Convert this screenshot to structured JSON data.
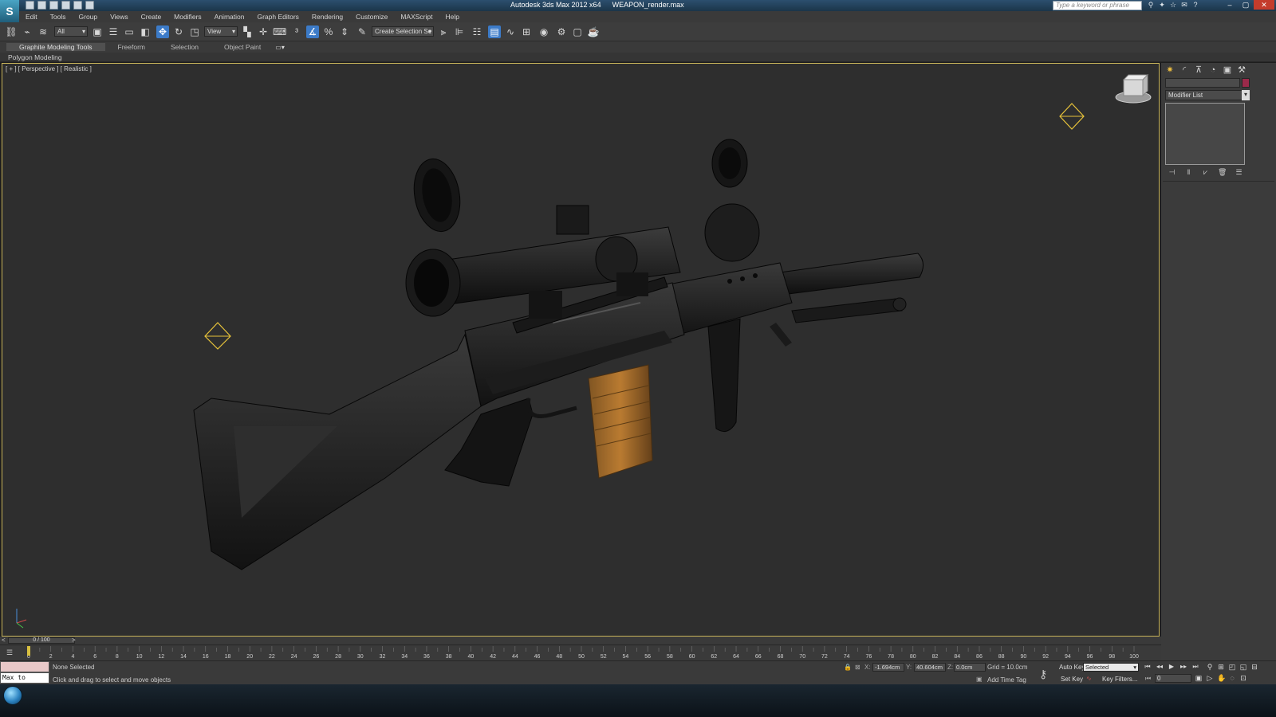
{
  "window": {
    "app_title": "Autodesk 3ds Max  2012 x64",
    "file_name": "WEAPON_render.max",
    "search_placeholder": "Type a keyword or phrase"
  },
  "menu": [
    "Edit",
    "Tools",
    "Group",
    "Views",
    "Create",
    "Modifiers",
    "Animation",
    "Graph Editors",
    "Rendering",
    "Customize",
    "MAXScript",
    "Help"
  ],
  "toolbar": {
    "selection_filter": "All",
    "reference_coord": "View",
    "named_selection": "Create Selection Se"
  },
  "ribbon": {
    "tabs": [
      "Graphite Modeling Tools",
      "Freeform",
      "Selection",
      "Object Paint"
    ],
    "active_tab": "Graphite Modeling Tools",
    "panel_label": "Polygon Modeling"
  },
  "viewport": {
    "label": "[ + ] [ Perspective ] [ Realistic ]",
    "border_color": "#c8b45a"
  },
  "command_panel": {
    "modifier_list": "Modifier List",
    "object_color": "#9b2a4a"
  },
  "timeline": {
    "slider_text": "0 / 100",
    "ticks": [
      0,
      2,
      4,
      6,
      8,
      10,
      12,
      14,
      16,
      18,
      20,
      22,
      24,
      26,
      28,
      30,
      32,
      34,
      36,
      38,
      40,
      42,
      44,
      46,
      48,
      50,
      52,
      54,
      56,
      58,
      60,
      62,
      64,
      66,
      68,
      70,
      72,
      74,
      76,
      78,
      80,
      82,
      84,
      86,
      88,
      90,
      92,
      94,
      96,
      98,
      100
    ]
  },
  "status": {
    "maxscript_listener": "Max to Physc.",
    "selection": "None Selected",
    "prompt": "Click and drag to select and move objects",
    "x_label": "X:",
    "x_value": "-1.694cm",
    "y_label": "Y:",
    "y_value": "40.604cm",
    "z_label": "Z:",
    "z_value": "0.0cm",
    "grid": "Grid = 10.0cm",
    "add_time_tag": "Add Time Tag",
    "auto_key": "Auto Key",
    "set_key": "Set Key",
    "key_mode": "Selected",
    "key_filters": "Key Filters...",
    "current_frame": "0"
  }
}
